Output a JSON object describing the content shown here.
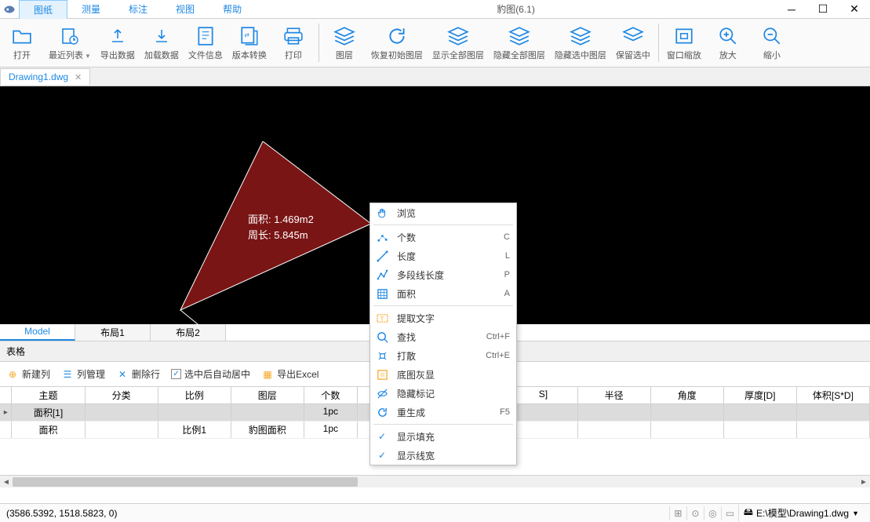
{
  "app": {
    "title": "豹图(6.1)"
  },
  "menu": {
    "tabs": [
      "图纸",
      "测量",
      "标注",
      "视图",
      "帮助"
    ]
  },
  "ribbon": [
    {
      "label": "打开",
      "icon": "folder"
    },
    {
      "label": "最近列表",
      "icon": "recent",
      "dd": true
    },
    {
      "label": "导出数据",
      "icon": "export"
    },
    {
      "label": "加载数据",
      "icon": "import"
    },
    {
      "label": "文件信息",
      "icon": "info"
    },
    {
      "label": "版本转换",
      "icon": "convert"
    },
    {
      "label": "打印",
      "icon": "print"
    },
    {
      "sep": true
    },
    {
      "label": "图层",
      "icon": "layers"
    },
    {
      "label": "恢复初始图层",
      "icon": "restore"
    },
    {
      "label": "显示全部图层",
      "icon": "layers-show"
    },
    {
      "label": "隐藏全部图层",
      "icon": "layers-hide",
      "dark": true
    },
    {
      "label": "隐藏选中图层",
      "icon": "layers-sel",
      "orange": true
    },
    {
      "label": "保留选中",
      "icon": "layers-keep",
      "dark": true
    },
    {
      "sep": true
    },
    {
      "label": "窗口缩放",
      "icon": "zoom-win"
    },
    {
      "label": "放大",
      "icon": "zoom-in"
    },
    {
      "label": "缩小",
      "icon": "zoom-out"
    }
  ],
  "file_tab": {
    "name": "Drawing1.dwg"
  },
  "shape": {
    "area_label": "面积: 1.469m2",
    "peri_label": "周长: 5.845m"
  },
  "layout_tabs": [
    "Model",
    "布局1",
    "布局2"
  ],
  "table": {
    "title": "表格",
    "tools": {
      "newcol": "新建列",
      "colmgr": "列管理",
      "delrow": "删除行",
      "autocenter": "选中后自动居中",
      "export": "导出Excel"
    },
    "cols": [
      "主题",
      "分类",
      "比例",
      "图层",
      "个数",
      "",
      "S]",
      "半径",
      "角度",
      "厚度[D]",
      "体积[S*D]"
    ],
    "rows": [
      {
        "sel": true,
        "cells": [
          "面积[1]",
          "",
          "",
          "",
          "1pc",
          "",
          "",
          "",
          "",
          "",
          ""
        ]
      },
      {
        "sel": false,
        "cells": [
          "面积",
          "",
          "比例1",
          "豹图面积",
          "1pc",
          "",
          "",
          "",
          "",
          "",
          ""
        ]
      }
    ]
  },
  "ctx": [
    {
      "icon": "hand",
      "label": "浏览"
    },
    {
      "sep": true
    },
    {
      "icon": "dots",
      "label": "个数",
      "key": "C"
    },
    {
      "icon": "line",
      "label": "长度",
      "key": "L"
    },
    {
      "icon": "poly",
      "label": "多段线长度",
      "key": "P"
    },
    {
      "icon": "area",
      "label": "面积",
      "key": "A"
    },
    {
      "sep": true
    },
    {
      "icon": "text",
      "label": "提取文字",
      "orange": true
    },
    {
      "icon": "search",
      "label": "查找",
      "key": "Ctrl+F"
    },
    {
      "icon": "explode",
      "label": "打散",
      "key": "Ctrl+E"
    },
    {
      "icon": "dim",
      "label": "底图灰显",
      "orange": true
    },
    {
      "icon": "hide",
      "label": "隐藏标记"
    },
    {
      "icon": "regen",
      "label": "重生成",
      "key": "F5"
    },
    {
      "sep": true
    },
    {
      "check": true,
      "label": "显示填充"
    },
    {
      "check": true,
      "label": "显示线宽"
    }
  ],
  "status": {
    "coords": "(3586.5392, 1518.5823, 0)",
    "path": "E:\\模型\\Drawing1.dwg"
  }
}
